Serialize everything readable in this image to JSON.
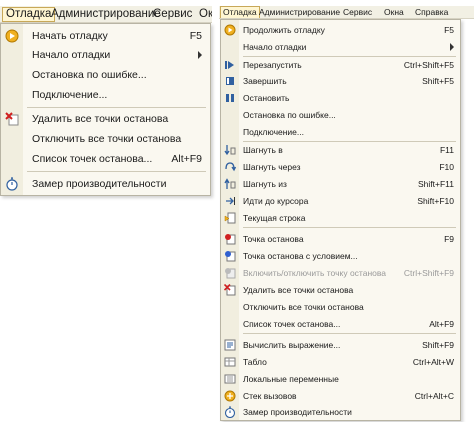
{
  "left": {
    "menubar": [
      "Отладка",
      "Администрирование",
      "Сервис",
      "Ок"
    ],
    "items": [
      {
        "label": "Начать отладку",
        "shortcut": "F5",
        "icon": "play-icon"
      },
      {
        "label": "Начало отладки",
        "submenu": true
      },
      {
        "label": "Остановка по ошибке..."
      },
      {
        "label": "Подключение..."
      },
      {
        "label": "Удалить все точки останова",
        "icon": "delete-breakpoints-icon"
      },
      {
        "label": "Отключить все точки останова"
      },
      {
        "label": "Список точек останова...",
        "shortcut": "Alt+F9"
      },
      {
        "label": "Замер производительности",
        "icon": "stopwatch-icon"
      }
    ]
  },
  "right": {
    "menubar": [
      "Отладка",
      "Администрирование",
      "Сервис",
      "Окна",
      "Справка"
    ],
    "items": [
      {
        "label": "Продолжить отладку",
        "shortcut": "F5",
        "icon": "continue-icon"
      },
      {
        "label": "Начало отладки",
        "submenu": true
      },
      {
        "label": "Перезапустить",
        "shortcut": "Ctrl+Shift+F5",
        "icon": "restart-icon"
      },
      {
        "label": "Завершить",
        "shortcut": "Shift+F5",
        "icon": "stop-square-icon"
      },
      {
        "label": "Остановить",
        "icon": "pause-icon"
      },
      {
        "label": "Остановка по ошибке..."
      },
      {
        "label": "Подключение..."
      },
      {
        "label": "Шагнуть в",
        "shortcut": "F11",
        "icon": "step-into-icon"
      },
      {
        "label": "Шагнуть через",
        "shortcut": "F10",
        "icon": "step-over-icon"
      },
      {
        "label": "Шагнуть из",
        "shortcut": "Shift+F11",
        "icon": "step-out-icon"
      },
      {
        "label": "Идти до курсора",
        "shortcut": "Shift+F10",
        "icon": "run-to-cursor-icon"
      },
      {
        "label": "Текущая строка",
        "icon": "current-line-icon"
      },
      {
        "label": "Точка останова",
        "shortcut": "F9",
        "icon": "breakpoint-icon"
      },
      {
        "label": "Точка останова с условием...",
        "icon": "conditional-breakpoint-icon"
      },
      {
        "label": "Включить/отключить точку останова",
        "shortcut": "Ctrl+Shift+F9",
        "icon": "toggle-breakpoint-icon",
        "disabled": true
      },
      {
        "label": "Удалить все точки останова",
        "icon": "delete-breakpoints-icon"
      },
      {
        "label": "Отключить все точки останова"
      },
      {
        "label": "Список точек останова...",
        "shortcut": "Alt+F9"
      },
      {
        "label": "Вычислить выражение...",
        "shortcut": "Shift+F9",
        "icon": "evaluate-icon"
      },
      {
        "label": "Табло",
        "shortcut": "Ctrl+Alt+W",
        "icon": "watch-icon"
      },
      {
        "label": "Локальные переменные",
        "icon": "locals-icon"
      },
      {
        "label": "Стек вызовов",
        "shortcut": "Ctrl+Alt+C",
        "icon": "call-stack-icon"
      },
      {
        "label": "Замер производительности",
        "icon": "stopwatch-icon"
      }
    ]
  }
}
